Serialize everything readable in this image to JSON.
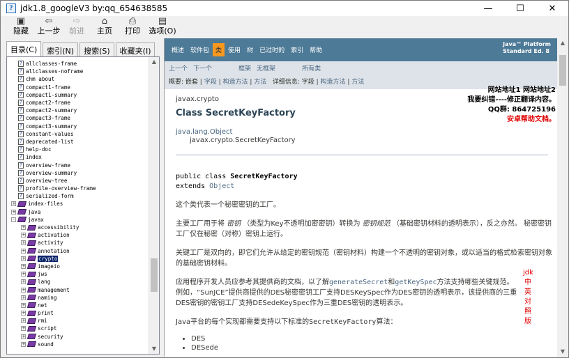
{
  "window": {
    "title": "jdk1.8_googleV3 by:qq_654638585",
    "minimize_glyph": "—",
    "maximize_glyph": "☐",
    "close_glyph": "✕"
  },
  "toolbar": {
    "hide": {
      "label": "隐藏",
      "icon": "hide-icon",
      "glyph": "▣"
    },
    "back": {
      "label": "上一步",
      "icon": "back-arrow-icon",
      "glyph": "⇦"
    },
    "forward": {
      "label": "前进",
      "icon": "forward-arrow-icon",
      "glyph": "⇨"
    },
    "home": {
      "label": "主页",
      "icon": "home-icon",
      "glyph": "⌂"
    },
    "print": {
      "label": "打印",
      "icon": "printer-icon",
      "glyph": "⎙"
    },
    "options": {
      "label": "选项(O)",
      "icon": "options-icon",
      "glyph": "▤"
    }
  },
  "left_tabs": [
    "目录(C)",
    "索引(N)",
    "搜索(S)",
    "收藏夹(I)"
  ],
  "tree": [
    {
      "label": "allclasses-frame",
      "kind": "doc",
      "depth": 1
    },
    {
      "label": "allclasses-noframe",
      "kind": "doc",
      "depth": 1
    },
    {
      "label": "chm about",
      "kind": "doc",
      "depth": 1
    },
    {
      "label": "compact1-frame",
      "kind": "doc",
      "depth": 1
    },
    {
      "label": "compact1-summary",
      "kind": "doc",
      "depth": 1
    },
    {
      "label": "compact2-frame",
      "kind": "doc",
      "depth": 1
    },
    {
      "label": "compact2-summary",
      "kind": "doc",
      "depth": 1
    },
    {
      "label": "compact3-frame",
      "kind": "doc",
      "depth": 1
    },
    {
      "label": "compact3-summary",
      "kind": "doc",
      "depth": 1
    },
    {
      "label": "constant-values",
      "kind": "doc",
      "depth": 1
    },
    {
      "label": "deprecated-list",
      "kind": "doc",
      "depth": 1
    },
    {
      "label": "help-doc",
      "kind": "doc",
      "depth": 1
    },
    {
      "label": "index",
      "kind": "doc",
      "depth": 1
    },
    {
      "label": "overview-frame",
      "kind": "doc",
      "depth": 1
    },
    {
      "label": "overview-summary",
      "kind": "doc",
      "depth": 1
    },
    {
      "label": "overview-tree",
      "kind": "doc",
      "depth": 1
    },
    {
      "label": "profile-overview-frame",
      "kind": "doc",
      "depth": 1
    },
    {
      "label": "serialized-form",
      "kind": "doc",
      "depth": 1
    },
    {
      "label": "index-files",
      "kind": "book",
      "depth": 0,
      "exp": "+"
    },
    {
      "label": "java",
      "kind": "book",
      "depth": 0,
      "exp": "+"
    },
    {
      "label": "javax",
      "kind": "openbook",
      "depth": 0,
      "exp": "-"
    },
    {
      "label": "accessibility",
      "kind": "book",
      "depth": 1,
      "exp": "+"
    },
    {
      "label": "activation",
      "kind": "book",
      "depth": 1,
      "exp": "+"
    },
    {
      "label": "activity",
      "kind": "book",
      "depth": 1,
      "exp": "+"
    },
    {
      "label": "annotation",
      "kind": "book",
      "depth": 1,
      "exp": "+"
    },
    {
      "label": "crypto",
      "kind": "book",
      "depth": 1,
      "exp": "+",
      "selected": true
    },
    {
      "label": "imageio",
      "kind": "book",
      "depth": 1,
      "exp": "+"
    },
    {
      "label": "jws",
      "kind": "book",
      "depth": 1,
      "exp": "+"
    },
    {
      "label": "lang",
      "kind": "book",
      "depth": 1,
      "exp": "+"
    },
    {
      "label": "management",
      "kind": "book",
      "depth": 1,
      "exp": "+"
    },
    {
      "label": "naming",
      "kind": "book",
      "depth": 1,
      "exp": "+"
    },
    {
      "label": "net",
      "kind": "book",
      "depth": 1,
      "exp": "+"
    },
    {
      "label": "print",
      "kind": "book",
      "depth": 1,
      "exp": "+"
    },
    {
      "label": "rmi",
      "kind": "book",
      "depth": 1,
      "exp": "+"
    },
    {
      "label": "script",
      "kind": "book",
      "depth": 1,
      "exp": "+"
    },
    {
      "label": "security",
      "kind": "book",
      "depth": 1,
      "exp": "+"
    },
    {
      "label": "sound",
      "kind": "book",
      "depth": 1,
      "exp": "+"
    }
  ],
  "tree_scroll": {
    "position": 0.78,
    "visible_fraction": 0.12
  },
  "navbar": {
    "items": [
      "概述",
      "软件包",
      "类",
      "使用",
      "树",
      "已过时的",
      "索引",
      "帮助"
    ],
    "active_index": 2,
    "brand_line1": "Java™ Platform",
    "brand_line2": "Standard Ed. 8"
  },
  "subnav": {
    "prev": "上一个",
    "next": "下一个",
    "frames": "框架",
    "noframes": "无框架",
    "allclasses": "所有类",
    "summary_prefix": "概要: ",
    "summary_items": [
      "嵌套",
      "字段",
      "构造方法",
      "方法"
    ],
    "detail_prefix": "详细信息: ",
    "detail_items": [
      "字段",
      "构造方法",
      "方法"
    ]
  },
  "doc": {
    "package": "javax.crypto",
    "class_title": "Class SecretKeyFactory",
    "super_link": "java.lang.Object",
    "self_path": "javax.crypto.SecretKeyFactory",
    "decl_1_pre": "public class ",
    "decl_1_name": "SecretKeyFactory",
    "decl_2_pre": "extends ",
    "decl_2_link": "Object",
    "p1": "这个类代表一个秘密密钥的工厂。",
    "p2": "主要工厂用于将 密钥 （类型为Key不透明加密密钥）转换为 密钥规范 （基础密钥材料的透明表示），反之亦然。 秘密密钥工厂仅在秘密（对称）密钥上运行。",
    "p3": "关键工厂是双向的，即它们允许从给定的密钥规范（密钥材料）构建一个不透明的密钥对象，或以适当的格式检索密钥对象的基础密钥材料。",
    "p4_a": "应用程序开发人员应参考其提供商的文档，以了解",
    "p4_link1": "generateSecret",
    "p4_b": "和",
    "p4_link2": "getKeySpec",
    "p4_c": "方法支持哪些关键规范。 例如，“SunJCE”提供商提供的DES秘密密钥工厂支持DESKeySpec作为DES密钥的透明表示，该提供商的三重DES密钥的密钥工厂支持DESedeKeySpec作为三重DES密钥的透明表示。",
    "p5_a": "Java平台的每个实现都需要支持以下标准的",
    "p5_code": "SecretKeyFactory",
    "p5_b": "算法：",
    "algorithms": [
      "DES",
      "DESede"
    ]
  },
  "overlay": {
    "line1": "网站地址1 网站地址2",
    "line2": "我要纠错----修正翻译内容。",
    "line3": "QQ群: 864725196",
    "line4": "安卓帮助文档。",
    "vertical_chars": [
      "jdk",
      "中",
      "英",
      "对",
      "照",
      "版"
    ]
  },
  "colors": {
    "navbar": "#4d7a97",
    "nav_active": "#f8981d",
    "subnav": "#dee3e9",
    "link": "#4a6782",
    "overlay_red": "#e00000",
    "tree_selected": "#0a246a"
  }
}
